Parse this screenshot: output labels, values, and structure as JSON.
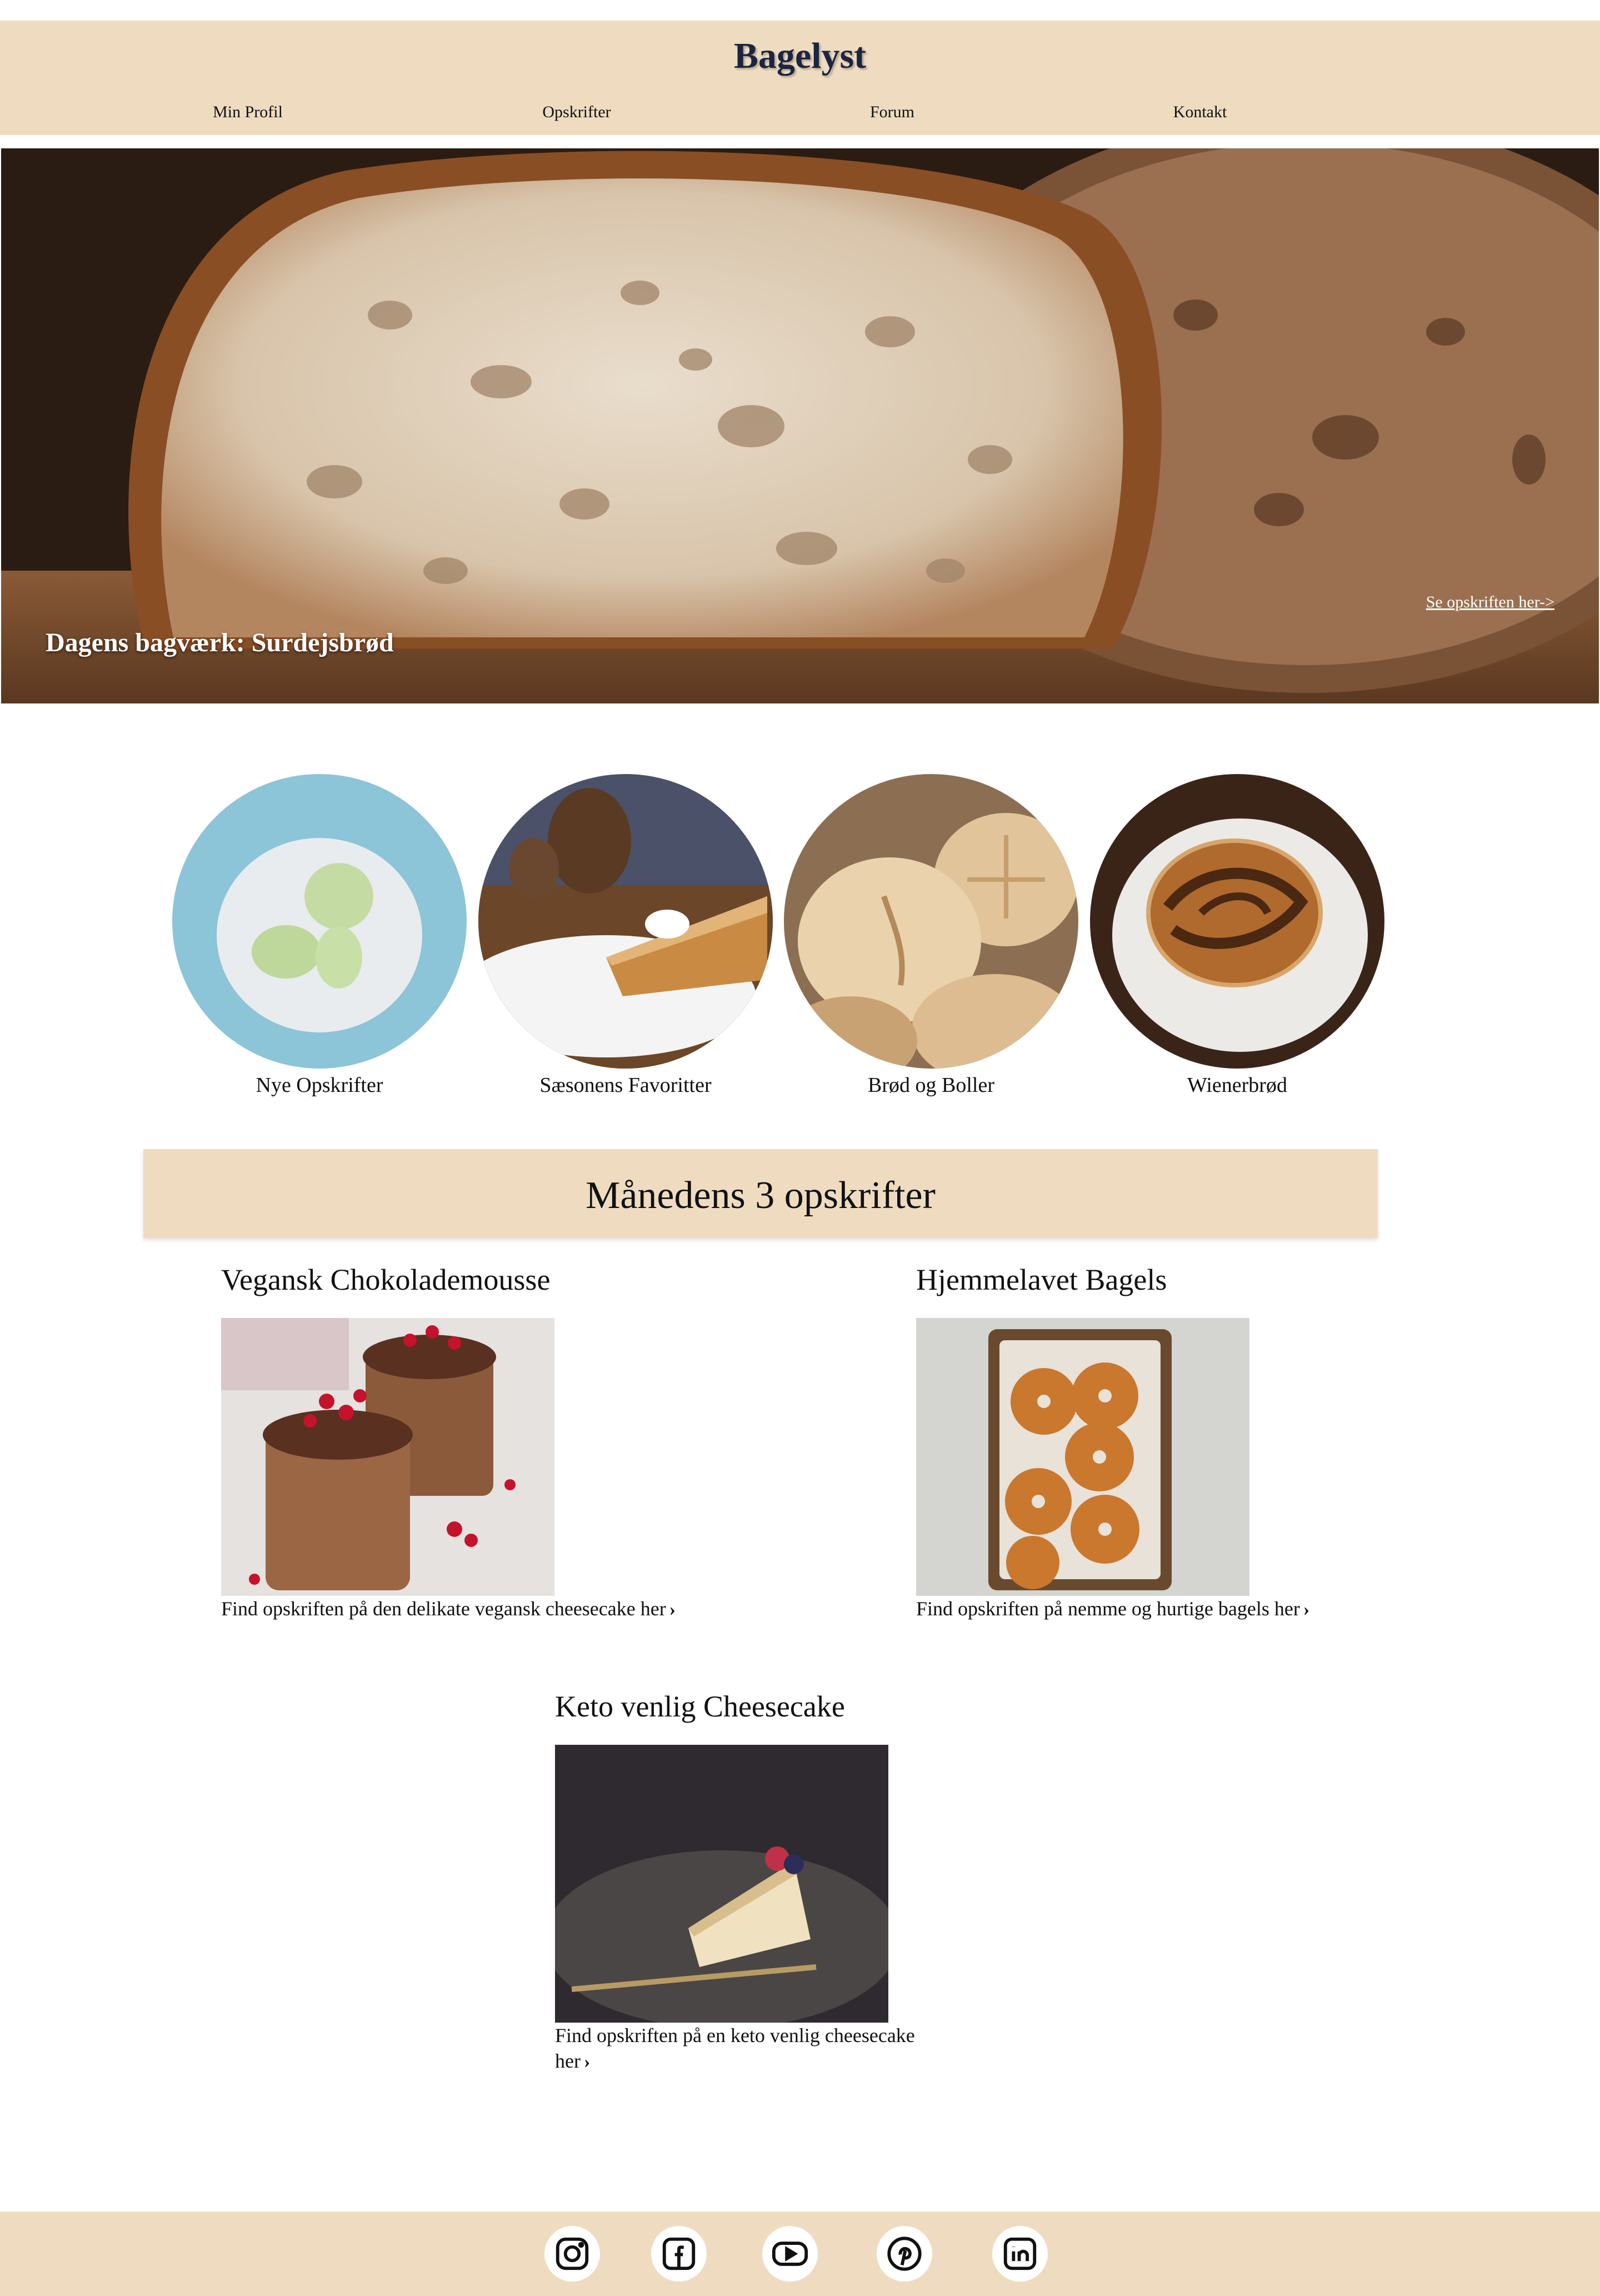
{
  "header": {
    "logo": "Bagelyst",
    "nav": [
      {
        "label": "Min Profil"
      },
      {
        "label": "Opskrifter"
      },
      {
        "label": "Forum"
      },
      {
        "label": "Kontakt"
      }
    ]
  },
  "hero": {
    "title": "Dagens bagværk: Surdejsbrød",
    "link": "Se opskriften her->"
  },
  "categories": [
    {
      "label": "Nye Opskrifter"
    },
    {
      "label": "Sæsonens Favoritter"
    },
    {
      "label": "Brød og Boller"
    },
    {
      "label": "Wienerbrød"
    }
  ],
  "monthly": {
    "title": "Månedens 3 opskrifter",
    "recipes": [
      {
        "title": "Vegansk Chokolademousse",
        "link": "Find opskriften på den delikate vegansk cheesecake her"
      },
      {
        "title": "Hjemmelavet Bagels",
        "link": "Find opskriften på nemme og hurtige bagels her"
      },
      {
        "title": "Keto venlig Cheesecake",
        "link": "Find opskriften på en keto venlig cheesecake her"
      }
    ]
  },
  "footer": {
    "icons": [
      "instagram-icon",
      "facebook-icon",
      "youtube-icon",
      "pinterest-icon",
      "linkedin-icon"
    ]
  },
  "colors": {
    "band": "#efdcc0",
    "logo": "#1c2540"
  }
}
